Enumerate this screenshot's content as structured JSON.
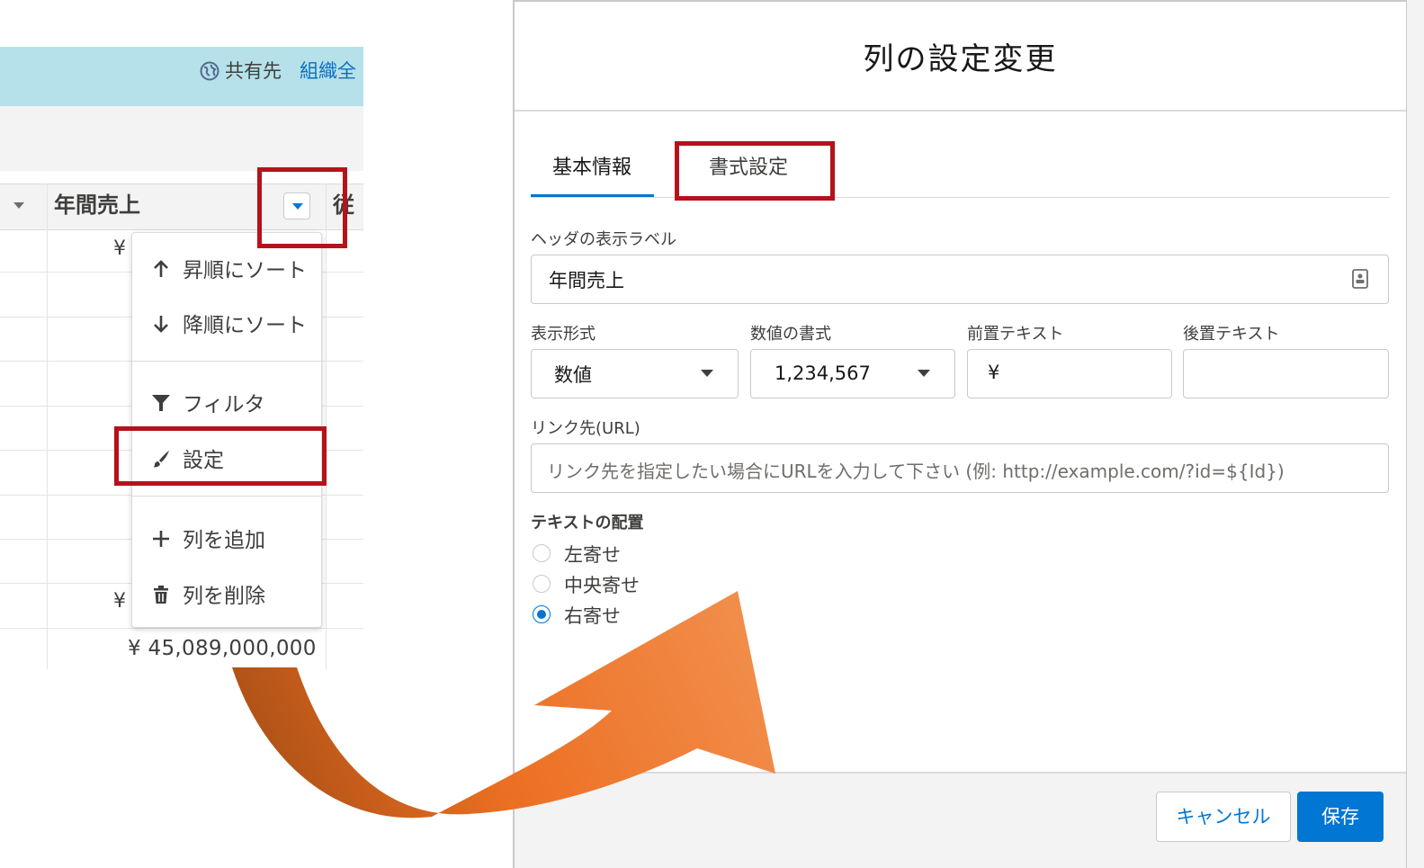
{
  "list_view": {
    "share_label": "共有先",
    "share_link": "組織全",
    "column_title": "年間売上",
    "next_column_partial": "従",
    "yen_symbol": "¥",
    "last_row_value": "¥ 45,089,000,000"
  },
  "column_menu": {
    "items": [
      {
        "label": "昇順にソート",
        "icon": "arrow-up-icon"
      },
      {
        "label": "降順にソート",
        "icon": "arrow-down-icon"
      },
      {
        "label": "フィルタ",
        "icon": "filter-icon"
      },
      {
        "label": "設定",
        "icon": "brush-icon"
      },
      {
        "label": "列を追加",
        "icon": "plus-icon"
      },
      {
        "label": "列を削除",
        "icon": "trash-icon"
      }
    ]
  },
  "modal": {
    "title": "列の設定変更",
    "tabs": [
      {
        "label": "基本情報",
        "active": true
      },
      {
        "label": "書式設定",
        "active": false
      }
    ],
    "header_label_field": {
      "label": "ヘッダの表示ラベル",
      "value": "年間売上"
    },
    "display_format": {
      "label": "表示形式",
      "value": "数値"
    },
    "number_format": {
      "label": "数値の書式",
      "value": "1,234,567"
    },
    "prefix_text": {
      "label": "前置テキスト",
      "value": "¥"
    },
    "suffix_text": {
      "label": "後置テキスト",
      "value": ""
    },
    "link_url": {
      "label": "リンク先(URL)",
      "placeholder": "リンク先を指定したい場合にURLを入力して下さい (例: http://example.com/?id=${Id})"
    },
    "alignment": {
      "label": "テキストの配置",
      "options": [
        {
          "label": "左寄せ",
          "checked": false
        },
        {
          "label": "中央寄せ",
          "checked": false
        },
        {
          "label": "右寄せ",
          "checked": true
        }
      ]
    },
    "footer": {
      "cancel_label": "キャンセル",
      "save_label": "保存"
    }
  },
  "colors": {
    "accent": "#0176d3",
    "highlight_box": "#b5121b",
    "arrow_orange": "#f08030",
    "share_bar": "#b6e1ea"
  }
}
